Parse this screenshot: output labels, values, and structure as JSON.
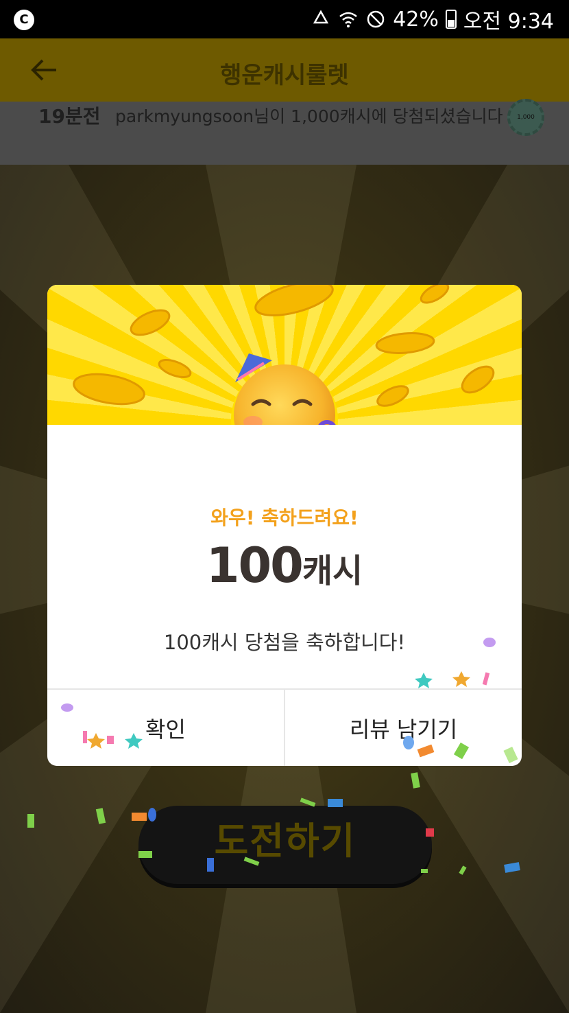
{
  "status_bar": {
    "left_badge": "C",
    "battery": "42%",
    "time": "오전 9:34"
  },
  "app_bar": {
    "title": "행운캐시룰렛",
    "back_icon": "arrow-left-icon"
  },
  "ticker": {
    "time_ago": "19분전",
    "message": "parkmyungsoon님이 1,000캐시에 당첨되셨습니다",
    "chip_label": "1,000"
  },
  "dialog": {
    "emoji": "partying-face-icon",
    "headline": "와우! 축하드려요!",
    "amount_value": "100",
    "amount_unit": "캐시",
    "message": "100캐시 당첨을 축하합니다!",
    "confirm_label": "확인",
    "review_label": "리뷰 남기기"
  },
  "challenge_button": {
    "label": "도전하기"
  },
  "colors": {
    "accent_yellow": "#ffd800",
    "headline_orange": "#f3a11c",
    "amount_text": "#3a3330"
  }
}
